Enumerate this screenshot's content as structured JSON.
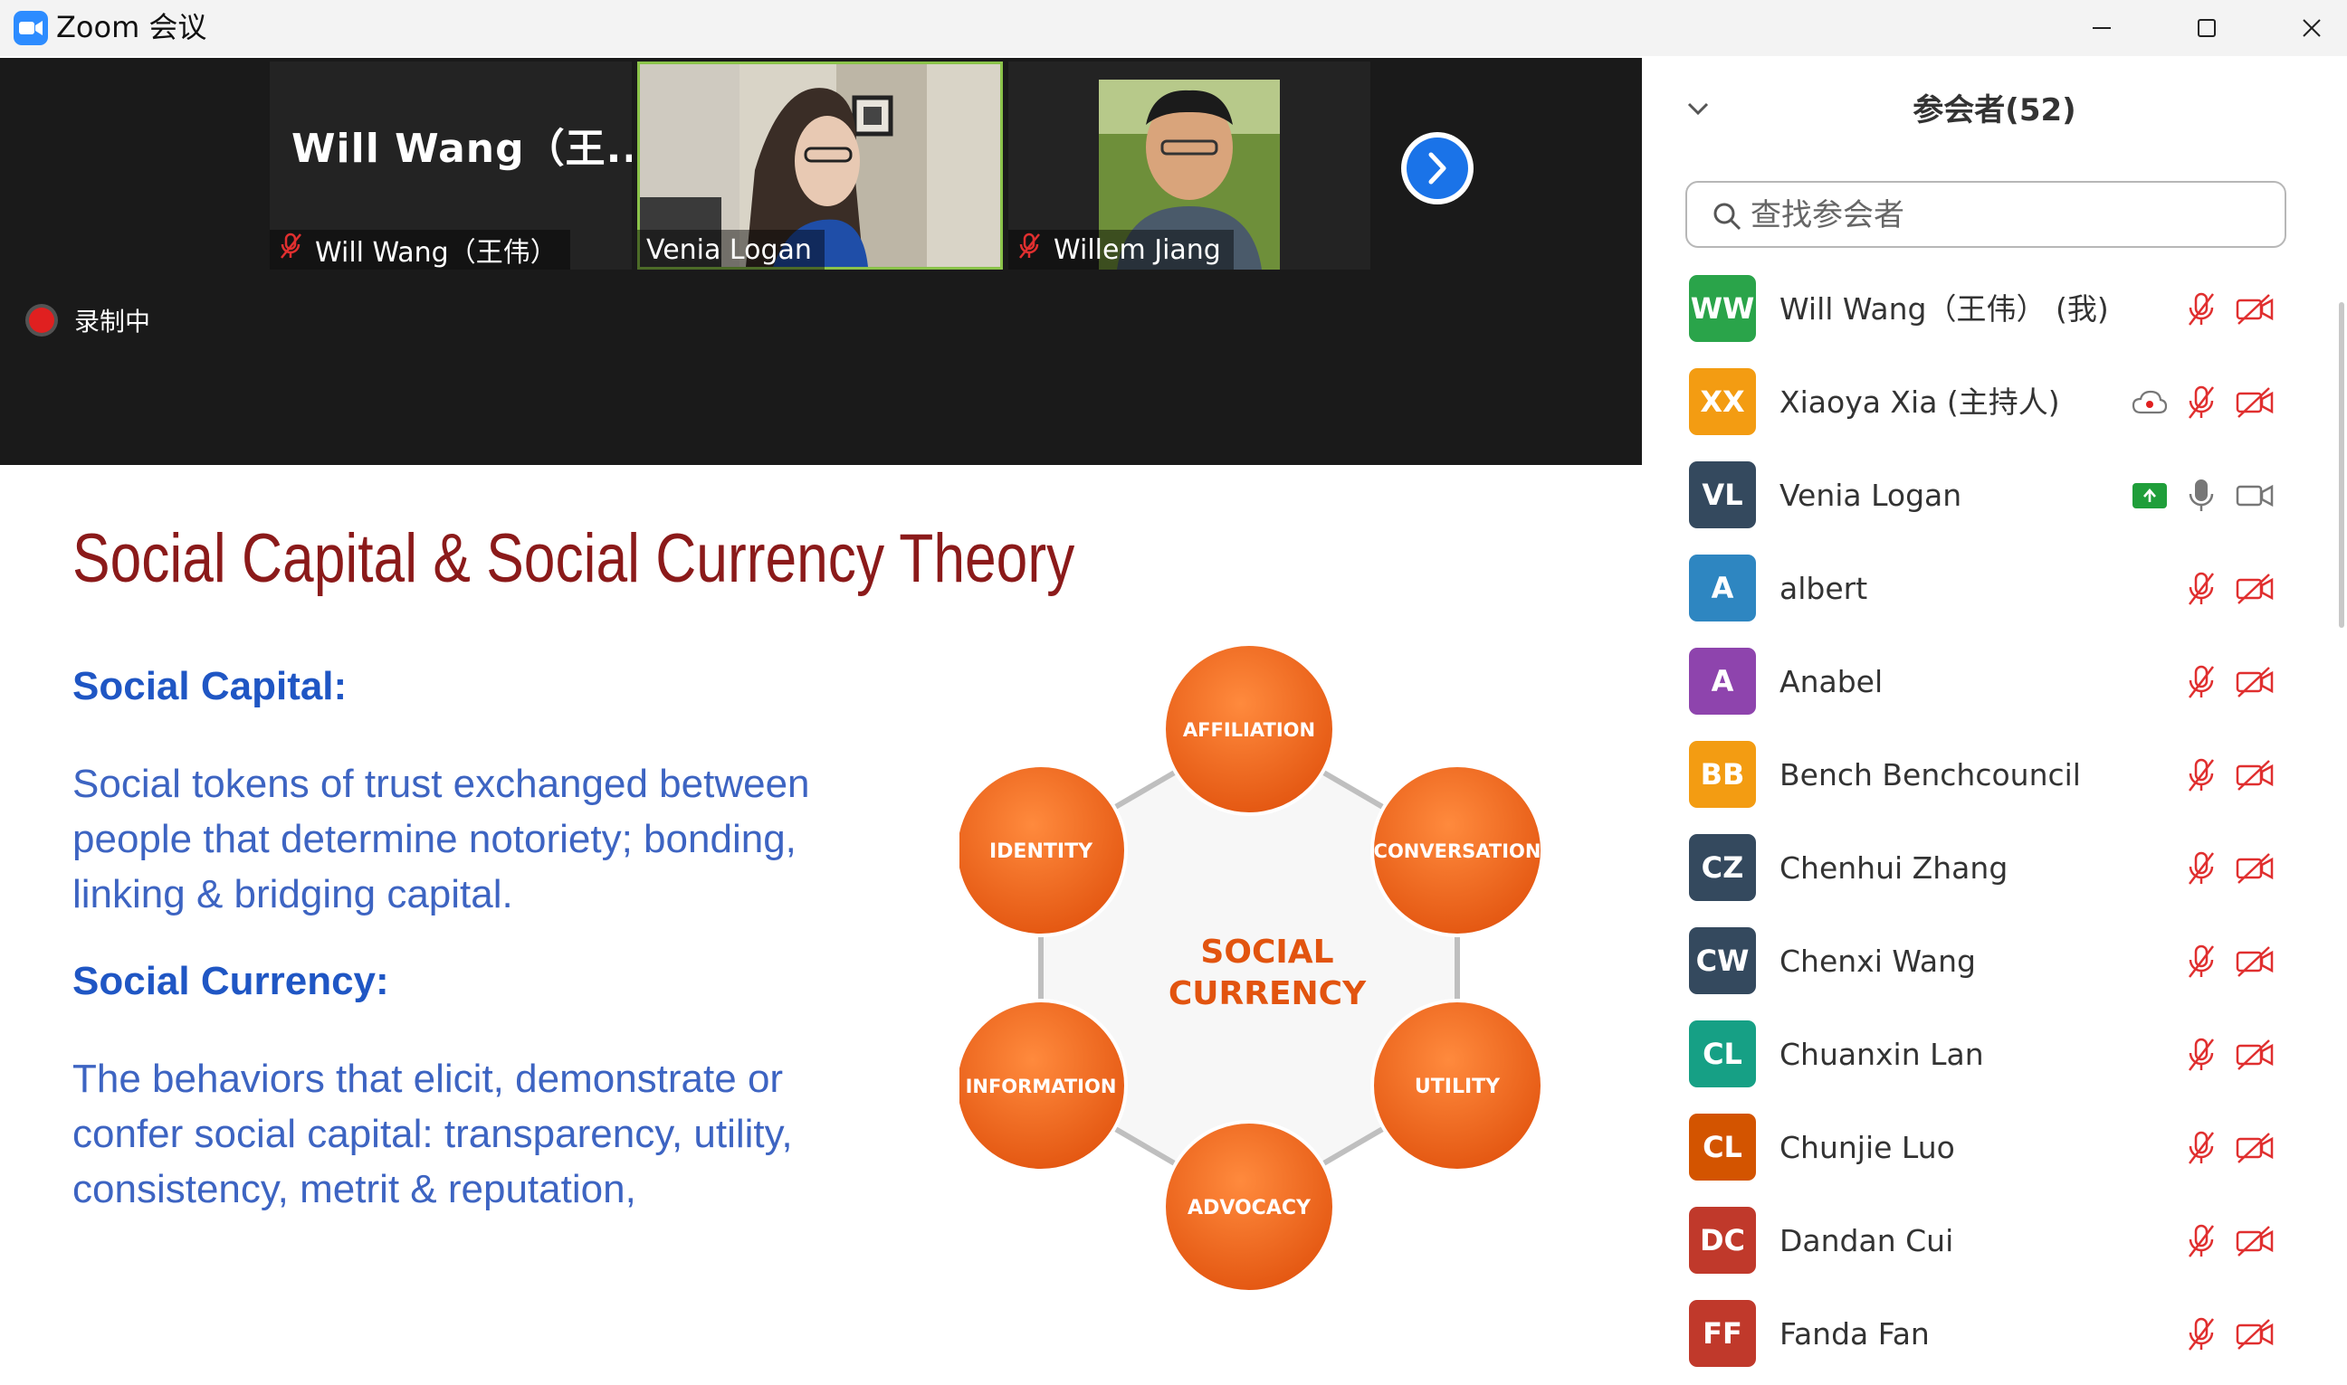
{
  "window": {
    "title": "Zoom 会议"
  },
  "colors": {
    "accent": "#2d8cff",
    "speaking_border": "#8bc34a",
    "muted_red": "#e02f2f",
    "slide_title": "#8b1a1a",
    "slide_heading": "#1f56c4",
    "slide_text": "#3d64c2",
    "circle_orange": "#f26522"
  },
  "gallery": {
    "tiles": [
      {
        "big_name": "Will Wang（王...",
        "label": "Will Wang（王伟）",
        "muted": true,
        "kind": "name"
      },
      {
        "label": "Venia Logan",
        "muted": false,
        "kind": "video",
        "speaking": true
      },
      {
        "label": "Willem Jiang",
        "muted": true,
        "kind": "video"
      }
    ],
    "next_icon": "chevron-right-icon"
  },
  "recording": {
    "label": "录制中"
  },
  "slide": {
    "title": "Social Capital & Social Currency Theory",
    "h1": "Social Capital:",
    "p1_lines": [
      "Social tokens of trust exchanged between",
      "people that determine notoriety; bonding,",
      "linking & bridging capital."
    ],
    "h2": "Social Currency:",
    "p2_lines": [
      "The behaviors that elicit, demonstrate or",
      "confer social capital: transparency, utility,",
      "consistency, metrit & reputation,"
    ],
    "diagram": {
      "center_lines": [
        "SOCIAL",
        "CURRENCY"
      ],
      "nodes": [
        "AFFILIATION",
        "CONVERSATION",
        "UTILITY",
        "ADVOCACY",
        "INFORMATION",
        "IDENTITY"
      ]
    }
  },
  "panel": {
    "title": "参会者(52)",
    "search_placeholder": "查找参会者",
    "participants": [
      {
        "initials": "WW",
        "name": "Will Wang（王伟） (我)",
        "color": "#2aa44a",
        "mic": "muted",
        "video": "off"
      },
      {
        "initials": "XX",
        "name": "Xiaoya Xia (主持人)",
        "color": "#f39c12",
        "mic": "muted",
        "video": "off",
        "cloud_record": true
      },
      {
        "initials": "VL",
        "name": "Venia Logan",
        "color": "#34495e",
        "mic": "on",
        "video": "on",
        "share": true
      },
      {
        "initials": "A",
        "name": "albert",
        "color": "#2e86c1",
        "mic": "muted",
        "video": "off"
      },
      {
        "initials": "A",
        "name": "Anabel",
        "color": "#8e44ad",
        "mic": "muted",
        "video": "off"
      },
      {
        "initials": "BB",
        "name": "Bench Benchcouncil",
        "color": "#f39c12",
        "mic": "muted",
        "video": "off"
      },
      {
        "initials": "CZ",
        "name": "Chenhui Zhang",
        "color": "#34495e",
        "mic": "muted",
        "video": "off"
      },
      {
        "initials": "CW",
        "name": "Chenxi Wang",
        "color": "#34495e",
        "mic": "muted",
        "video": "off"
      },
      {
        "initials": "CL",
        "name": "Chuanxin Lan",
        "color": "#16a085",
        "mic": "muted",
        "video": "off"
      },
      {
        "initials": "CL",
        "name": "Chunjie Luo",
        "color": "#d35400",
        "mic": "muted",
        "video": "off"
      },
      {
        "initials": "DC",
        "name": "Dandan Cui",
        "color": "#c0392b",
        "mic": "muted",
        "video": "off"
      },
      {
        "initials": "FF",
        "name": "Fanda Fan",
        "color": "#c0392b",
        "mic": "muted",
        "video": "off"
      }
    ]
  }
}
